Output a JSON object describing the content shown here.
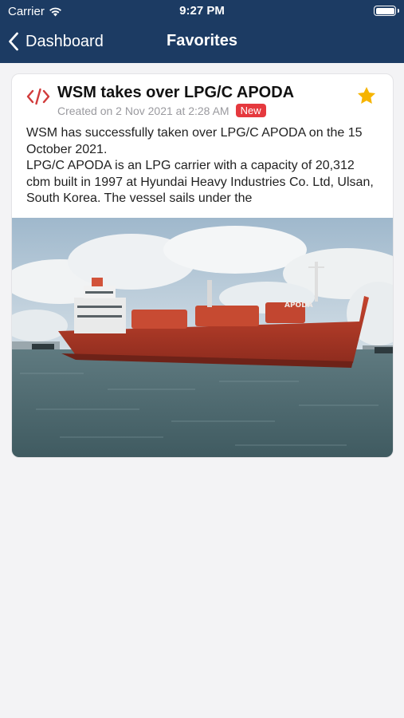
{
  "status_bar": {
    "carrier": "Carrier",
    "time": "9:27 PM"
  },
  "nav": {
    "back_label": "Dashboard",
    "title": "Favorites"
  },
  "article": {
    "title": "WSM takes over LPG/C APODA",
    "created": "Created on 2 Nov 2021 at 2:28 AM",
    "badge": "New",
    "body_line1": "WSM has successfully taken over LPG/C APODA on the 15 October 2021.",
    "body_line2": "LPG/C APODA is an LPG carrier with a capacity of 20,312 cbm built in 1997 at Hyundai Heavy Industries Co. Ltd, Ulsan, South Korea. The vessel sails under the",
    "image_text": "APODA",
    "favorited": true
  },
  "colors": {
    "header": "#1c3b63",
    "badge": "#e5393e",
    "star": "#f6b400",
    "code_icon": "#d13b3b"
  },
  "icons": {
    "back": "chevron-left-icon",
    "type": "code-icon",
    "favorite": "star-icon",
    "wifi": "wifi-icon",
    "battery": "battery-icon"
  }
}
